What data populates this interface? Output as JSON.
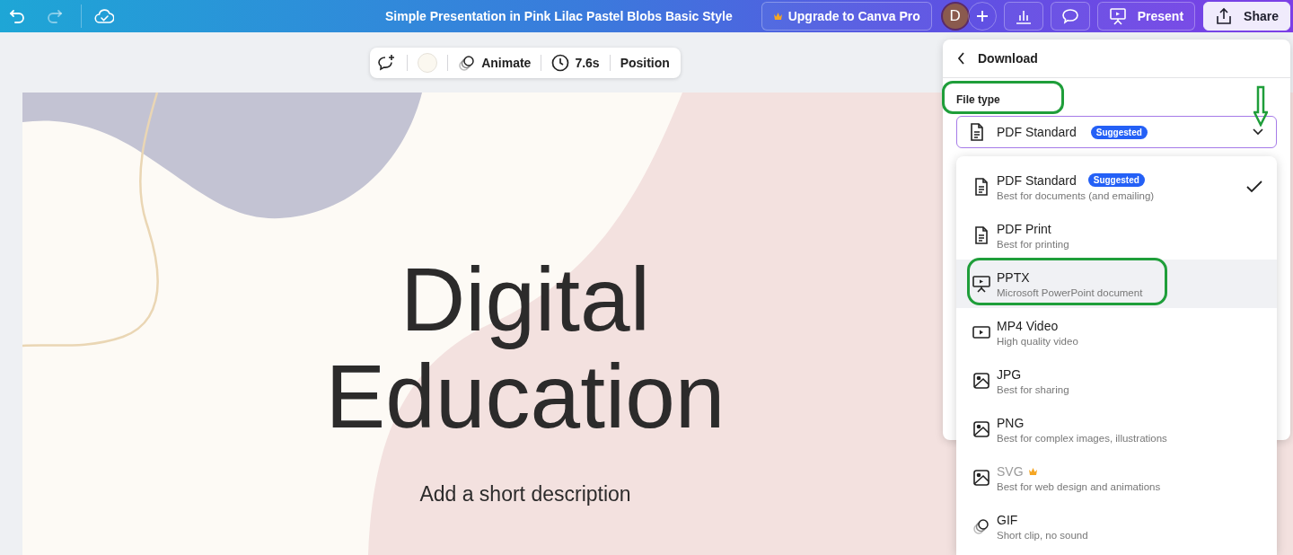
{
  "top_bar": {
    "undo": {
      "disabled": false
    },
    "redo": {
      "disabled": true
    },
    "title": "Simple Presentation in Pink Lilac Pastel Blobs Basic Style",
    "upgrade_button": "Upgrade to Canva Pro",
    "avatar_initial": "D",
    "present_button": "Present",
    "share_button": "Share"
  },
  "toolbar": {
    "animate": "Animate",
    "duration": "7.6s",
    "position": "Position"
  },
  "slide": {
    "title_lines": [
      "Digital",
      "Education"
    ],
    "description": "Add a short description"
  },
  "download_panel": {
    "title": "Download",
    "file_type_label": "File type",
    "file_type_annotated": true,
    "selected_type": "PDF Standard",
    "selected_badge": "Suggested",
    "dropdown_annotated": true,
    "options": [
      {
        "kind": "document",
        "title": "PDF Standard",
        "badge": "Suggested",
        "subtitle": "Best for documents (and emailing)",
        "selected": true,
        "highlighted": false,
        "pro": false,
        "annotated": false
      },
      {
        "kind": "document",
        "title": "PDF Print",
        "subtitle": "Best for printing",
        "selected": false,
        "highlighted": false,
        "pro": false,
        "annotated": false
      },
      {
        "kind": "presentation",
        "title": "PPTX",
        "subtitle": "Microsoft PowerPoint document",
        "selected": false,
        "highlighted": true,
        "pro": false,
        "annotated": true
      },
      {
        "kind": "video",
        "title": "MP4 Video",
        "subtitle": "High quality video",
        "selected": false,
        "highlighted": false,
        "pro": false,
        "annotated": false
      },
      {
        "kind": "image",
        "title": "JPG",
        "subtitle": "Best for sharing",
        "selected": false,
        "highlighted": false,
        "pro": false,
        "annotated": false
      },
      {
        "kind": "image",
        "title": "PNG",
        "subtitle": "Best for complex images, illustrations",
        "selected": false,
        "highlighted": false,
        "pro": false,
        "annotated": false
      },
      {
        "kind": "image",
        "title": "SVG",
        "subtitle": "Best for web design and animations",
        "selected": false,
        "highlighted": false,
        "pro": true,
        "annotated": false
      },
      {
        "kind": "gif",
        "title": "GIF",
        "subtitle": "Short clip, no sound",
        "selected": false,
        "highlighted": false,
        "pro": false,
        "annotated": false
      }
    ]
  }
}
